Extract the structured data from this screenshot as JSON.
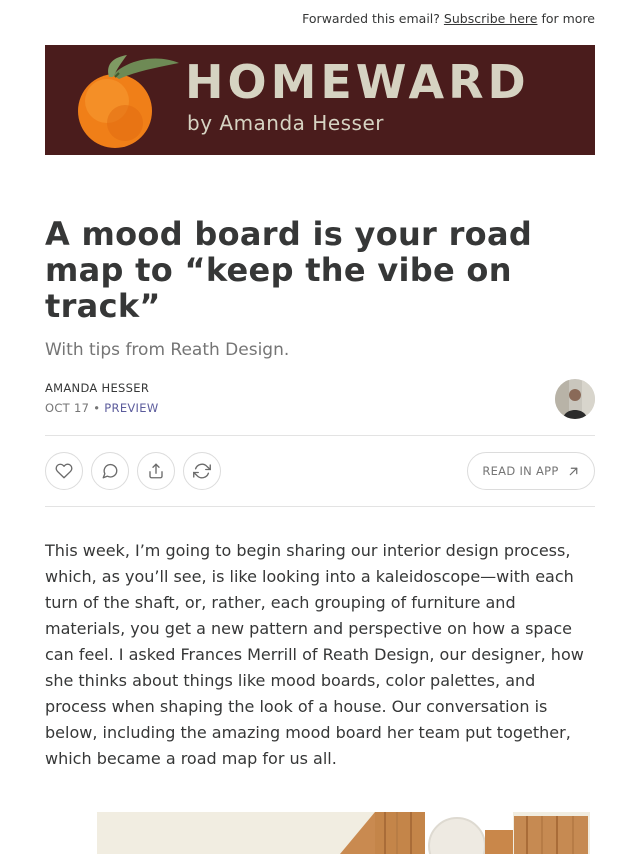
{
  "header": {
    "forward_prefix": "Forwarded this email?",
    "subscribe_link": "Subscribe here",
    "forward_suffix": "for more"
  },
  "banner": {
    "brand": "HOMEWARD",
    "byline": "by Amanda Hesser",
    "logo_icon": "orange-icon",
    "background_color": "#4a1c1c",
    "text_color": "#d6d3c2"
  },
  "post": {
    "title": "A mood board is your road map to “keep the vibe on track”",
    "subtitle": "With tips from Reath Design.",
    "author": "AMANDA HESSER",
    "date": "OCT 17",
    "separator": "•",
    "preview_label": "PREVIEW"
  },
  "actions": {
    "like_icon": "heart-icon",
    "comment_icon": "comment-icon",
    "share_icon": "share-icon",
    "restack_icon": "restack-icon",
    "read_in_app": "READ IN APP",
    "read_in_app_icon": "arrow-up-right-icon"
  },
  "content": {
    "paragraph": "This week, I’m going to begin sharing our interior design process, which, as you’ll see, is like looking into a kaleidoscope—with each turn of the shaft, or, rather, each grouping of furniture and materials, you get a new pattern and perspective on how a space can feel. I asked Frances Merrill of Reath Design, our designer, how she thinks about things like mood boards, color palettes, and process when shaping the look of a house. Our conversation is below, including the amazing mood board her team put together, which became a road map for us all."
  }
}
